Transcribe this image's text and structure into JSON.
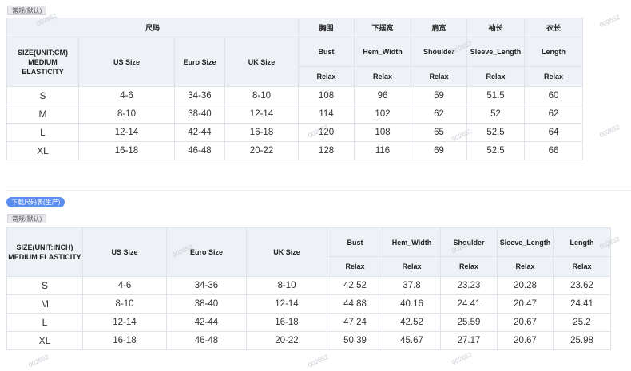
{
  "tags": {
    "top_standard": "常规(默认)",
    "download": "下载尺码表(生产)",
    "bottom_standard": "常规(默认)"
  },
  "table1": {
    "group_header": "尺码",
    "cn_headers": [
      "胸围",
      "下摆宽",
      "肩宽",
      "袖长",
      "衣长"
    ],
    "size_label": "SIZE(UNIT:CM) MEDIUM ELASTICITY",
    "size_cols": [
      "US Size",
      "Euro Size",
      "UK Size"
    ],
    "measure_cols": [
      "Bust",
      "Hem_Width",
      "Shoulder",
      "Sleeve_Length",
      "Length"
    ],
    "fit": [
      "Relax",
      "Relax",
      "Relax",
      "Relax",
      "Relax"
    ],
    "rows": [
      [
        "S",
        "4-6",
        "34-36",
        "8-10",
        "108",
        "96",
        "59",
        "51.5",
        "60"
      ],
      [
        "M",
        "8-10",
        "38-40",
        "12-14",
        "114",
        "102",
        "62",
        "52",
        "62"
      ],
      [
        "L",
        "12-14",
        "42-44",
        "16-18",
        "120",
        "108",
        "65",
        "52.5",
        "64"
      ],
      [
        "XL",
        "16-18",
        "46-48",
        "20-22",
        "128",
        "116",
        "69",
        "52.5",
        "66"
      ]
    ]
  },
  "table2": {
    "size_label": "SIZE(UNIT:INCH) MEDIUM ELASTICITY",
    "size_cols": [
      "US Size",
      "Euro Size",
      "UK Size"
    ],
    "measure_cols": [
      "Bust",
      "Hem_Width",
      "Shoulder",
      "Sleeve_Length",
      "Length"
    ],
    "fit": [
      "Relax",
      "Relax",
      "Relax",
      "Relax",
      "Relax"
    ],
    "rows": [
      [
        "S",
        "4-6",
        "34-36",
        "8-10",
        "42.52",
        "37.8",
        "23.23",
        "20.28",
        "23.62"
      ],
      [
        "M",
        "8-10",
        "38-40",
        "12-14",
        "44.88",
        "40.16",
        "24.41",
        "20.47",
        "24.41"
      ],
      [
        "L",
        "12-14",
        "42-44",
        "16-18",
        "47.24",
        "42.52",
        "25.59",
        "20.67",
        "25.2"
      ],
      [
        "XL",
        "16-18",
        "46-48",
        "20-22",
        "50.39",
        "45.67",
        "27.17",
        "20.67",
        "25.98"
      ]
    ]
  },
  "watermark": "002652"
}
